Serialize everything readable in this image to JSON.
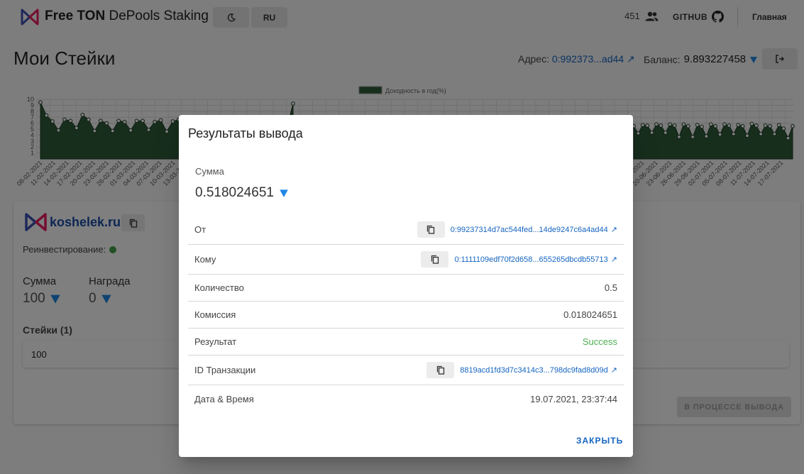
{
  "header": {
    "title_bold": "Free TON",
    "title_rest": " DePools Staking",
    "theme_icon": "moon-icon",
    "lang_label": "RU",
    "users_count": "451",
    "github_label": "GITHUB",
    "home_label": "Главная"
  },
  "page": {
    "title": "Мои Стейки",
    "address_label": "Адрес:",
    "address_value": "0:992373...ad44",
    "balance_label": "Баланс:",
    "balance_value": "9.893227458"
  },
  "chart_data": {
    "type": "area",
    "legend": "Доходность в год(%)",
    "legend_position": "top-center",
    "ylim": [
      0,
      10
    ],
    "yticks": [
      1,
      2,
      3,
      4,
      5,
      6,
      7,
      8,
      9,
      10
    ],
    "color": "#2e5d3a",
    "x_labels_left": [
      "08-02-2021",
      "11-02-2021",
      "14-02-2021",
      "17-02-2021",
      "20-02-2021",
      "23-02-2021",
      "26-02-2021",
      "01-03-2021",
      "04-03-2021",
      "07-03-2021",
      "10-03-2021",
      "13-03-2021"
    ],
    "x_labels_right": [
      "17-06-2021",
      "20-06-2021",
      "23-06-2021",
      "26-06-2021",
      "29-06-2021",
      "02-07-2021",
      "05-07-2021",
      "08-07-2021",
      "11-07-2021",
      "14-07-2021",
      "17-07-2021"
    ],
    "values_left": [
      9.5,
      7.3,
      6.3,
      4.8,
      6.6,
      6.4,
      5.2,
      7.4,
      6.6,
      4.7,
      6.4,
      6.0,
      4.7,
      6.4,
      6.2,
      4.8,
      6.4,
      6.4,
      4.9,
      6.2,
      6.5,
      4.6,
      6.3,
      6.6,
      5.4,
      6.6,
      6.3,
      4.7,
      6.5,
      5.6,
      4.3,
      6.3,
      5.5,
      4.6,
      6.2,
      5.7,
      4.4,
      6.4,
      5.7,
      4.4,
      6.1,
      5.3,
      9.3
    ],
    "values_right": [
      5.5,
      4.3,
      5.7,
      5.6,
      4.4,
      5.8,
      5.6,
      4.4,
      5.8,
      5.6,
      3.7,
      5.8,
      5.5,
      3.7,
      5.7,
      5.4,
      3.8,
      5.8,
      5.5,
      4.1,
      5.8,
      5.6,
      4.2,
      5.7,
      5.5,
      3.9,
      5.9,
      5.6,
      4.2,
      5.6,
      5.5,
      4.2,
      5.7,
      5.1,
      3.5,
      5.5
    ]
  },
  "pool": {
    "name": "koshelek.ru",
    "reinvest_label": "Реинвестирование:",
    "sum_label": "Сумма",
    "sum_value": "100",
    "reward_label": "Награда",
    "reward_value": "0",
    "stakes_title": "Стейки (1)",
    "stake_row_value": "100",
    "withdraw_button": "В ПРОЦЕССЕ ВЫВОДА"
  },
  "dialog": {
    "title": "Результаты вывода",
    "sum_label": "Сумма",
    "sum_value": "0.518024651",
    "rows": {
      "from_label": "От",
      "from_value": "0:99237314d7ac544fed...14de9247c6a4ad44",
      "to_label": "Кому",
      "to_value": "0:1111109edf70f2d658...655265dbcdb55713",
      "amount_label": "Количество",
      "amount_value": "0.5",
      "fee_label": "Комиссия",
      "fee_value": "0.018024651",
      "result_label": "Результат",
      "result_value": "Success",
      "txid_label": "ID Транзакции",
      "txid_value": "8819acd1fd3d7c3414c3...798dc9fad8d09d",
      "datetime_label": "Дата & Время",
      "datetime_value": "19.07.2021, 23:37:44"
    },
    "close_button": "ЗАКРЫТЬ"
  },
  "colors": {
    "accent": "#1565c0",
    "success": "#4caf50",
    "ton_blue": "#1e88e5",
    "chart_fill": "#2e5d3a",
    "reinvest_dot": "#43a047"
  }
}
